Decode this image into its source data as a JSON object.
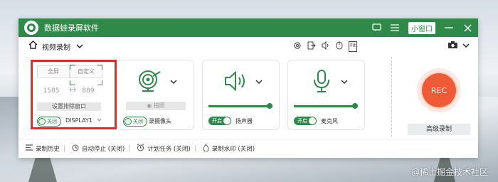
{
  "app": {
    "title": "数据蛙录屏软件",
    "mini_window": "小窗口"
  },
  "toolbar": {
    "mode": "视频录制",
    "fit_label": "Fit"
  },
  "screen": {
    "tab_fullscreen": "全屏",
    "tab_custom": "自定义",
    "width": "1585",
    "height": "889",
    "exclude_window_button": "设置排除窗口",
    "toggle_label": "关闭",
    "display": "DISPLAY1"
  },
  "camera": {
    "snapshot_button": "拍照",
    "toggle_label": "关闭",
    "label": "录摄像头"
  },
  "speaker": {
    "toggle_label": "开启",
    "label": "扬声器",
    "volume": 0.95
  },
  "mic": {
    "toggle_label": "开启",
    "label": "麦克风",
    "volume": 0.95
  },
  "rec": {
    "label": "REC",
    "advanced": "高级录制"
  },
  "status": {
    "history": "录制历史",
    "auto_stop": "自动停止 (关闭)",
    "schedule": "计划任务 (关闭)",
    "watermark": "录制水印 (关闭)"
  },
  "desktop": {
    "watermark": "@稀土掘金技术社区"
  },
  "colors": {
    "brand": "#2f8a4a",
    "rec": "#ef5b37",
    "highlight": "#e02a2a"
  }
}
